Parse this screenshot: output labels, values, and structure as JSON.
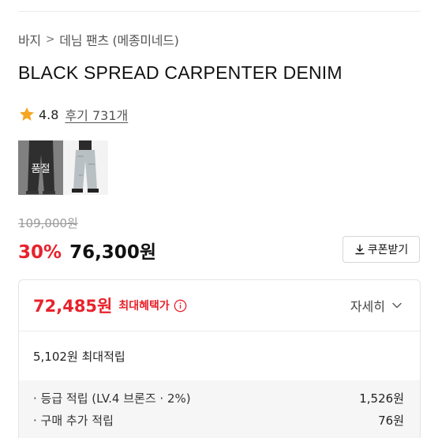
{
  "breadcrumb": {
    "category": "바지",
    "separator": ">",
    "subcategory": "데님 팬츠 (메종미네드)"
  },
  "product": {
    "title": "BLACK SPREAD CARPENTER DENIM",
    "rating": "4.8",
    "reviews": "후기 731개",
    "thumbnails": [
      {
        "name": "black-denim",
        "badge": "품절"
      },
      {
        "name": "light-denim",
        "badge": ""
      }
    ]
  },
  "price": {
    "original": "109,000원",
    "discount": "30%",
    "final": "76,300원",
    "coupon_label": "쿠폰받기"
  },
  "benefit": {
    "max_price": "72,485원",
    "max_label": "최대혜택가",
    "detail_label": "자세히",
    "max_points": "5,102원 최대적립",
    "rows": [
      {
        "label": "· 등급 적립 (LV.4 브론즈 · 2%)",
        "amount": "1,526원"
      },
      {
        "label": "· 구매 추가 적립",
        "amount": "76원"
      }
    ]
  },
  "colors": {
    "accent": "#e8222b",
    "star": "#f5a623",
    "text": "#111111",
    "muted": "#9a9a9a"
  }
}
